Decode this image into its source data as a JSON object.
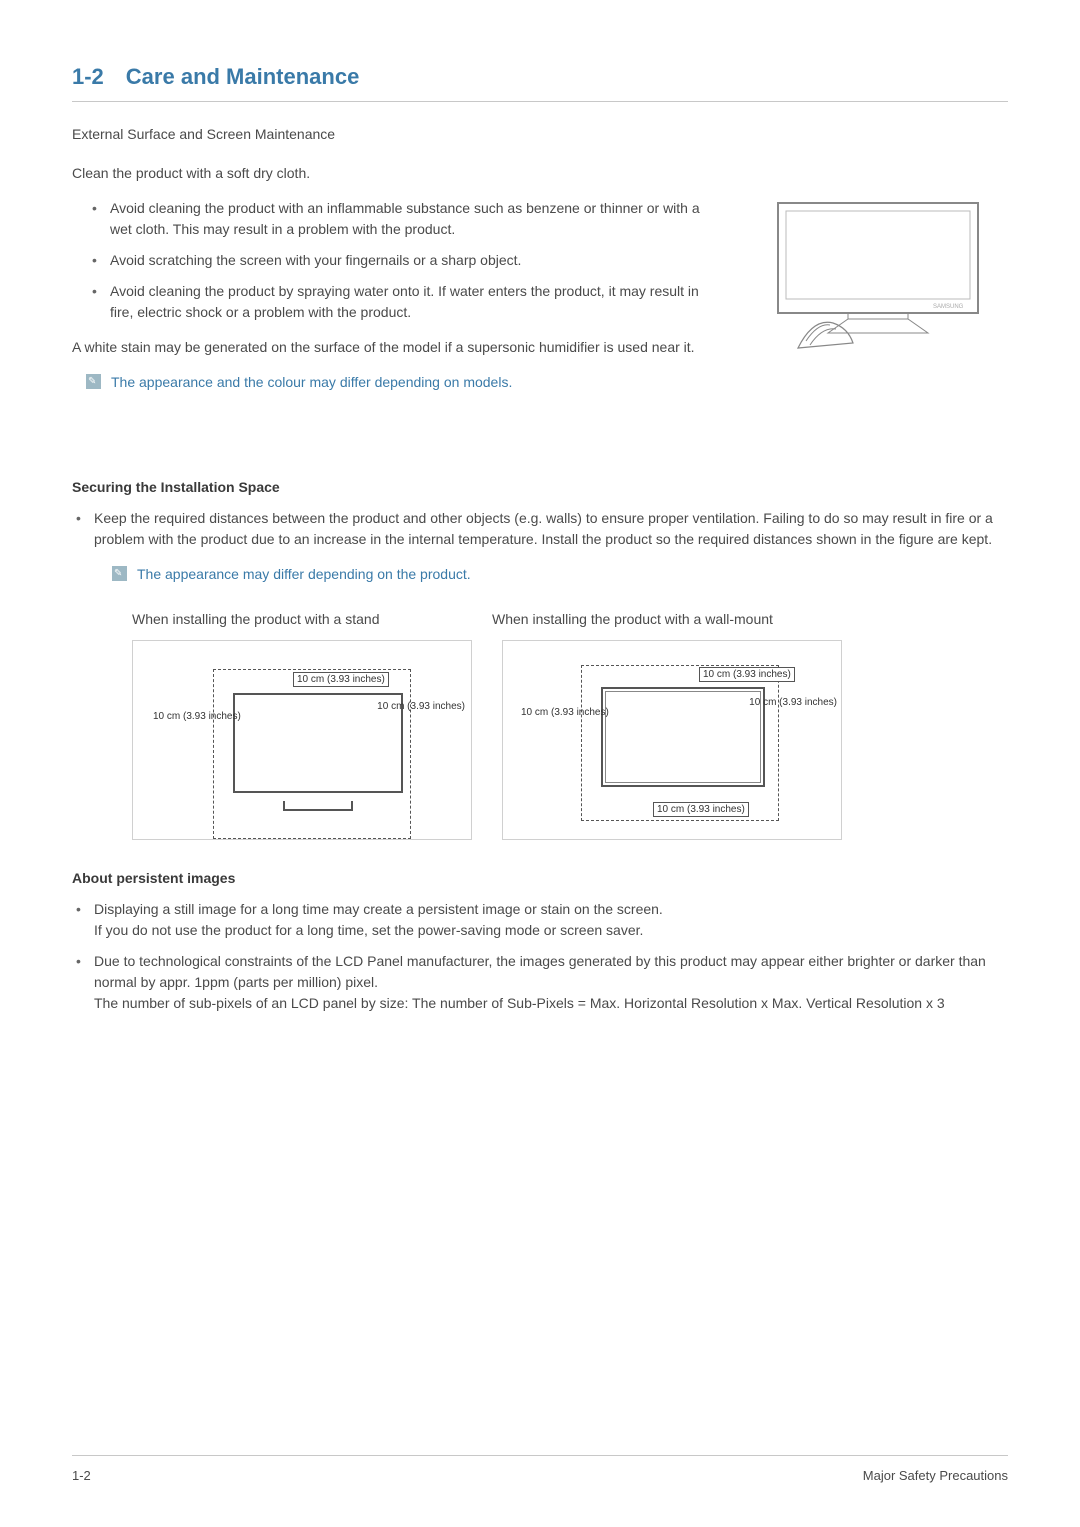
{
  "section": {
    "number": "1-2",
    "title": "Care and Maintenance"
  },
  "external": {
    "heading": "External Surface and Screen Maintenance",
    "intro": "Clean the product with a soft dry cloth.",
    "bullets": [
      "Avoid cleaning the product with an inflammable substance such as benzene or thinner or with a wet cloth. This may result in a problem with the product.",
      "Avoid scratching the screen with your fingernails or a sharp object.",
      "Avoid cleaning the product by spraying water onto it. If water enters the product, it may result in fire, electric shock or a problem with the product."
    ],
    "stain_note": "A white stain may be generated on the surface of the model if a supersonic humidifier is used near it.",
    "appearance_note": "The appearance and the colour may differ depending on models."
  },
  "securing": {
    "heading": "Securing the Installation Space",
    "bullet": "Keep the required distances between the product and other objects (e.g. walls) to ensure proper ventilation. Failing to do so may result in fire or a problem with the product due to an increase in the internal temperature. Install the product so the required distances shown in the figure are kept.",
    "appearance_note": "The appearance may differ depending on the product.",
    "caption_stand": "When installing the product with a stand",
    "caption_wall": "When installing the product with a wall-mount",
    "dim_top": "10 cm (3.93 inches)",
    "dim_side": "10 cm\n(3.93 inches)",
    "dim_bottom": "10 cm (3.93 inches)"
  },
  "persistent": {
    "heading": "About persistent images",
    "bullets": [
      "Displaying a still image for a long time may create a persistent image or stain on the screen.\nIf you do not use the product for a long time, set the power-saving mode or screen saver.",
      "Due to technological constraints of the LCD Panel manufacturer, the images generated by this product may appear either brighter or darker than normal by appr. 1ppm (parts per million) pixel.\nThe number of sub-pixels of an LCD panel by size:  The number of Sub-Pixels = Max. Horizontal Resolution x Max. Vertical Resolution x 3"
    ]
  },
  "footer": {
    "left": "1-2",
    "right": "Major Safety Precautions"
  }
}
